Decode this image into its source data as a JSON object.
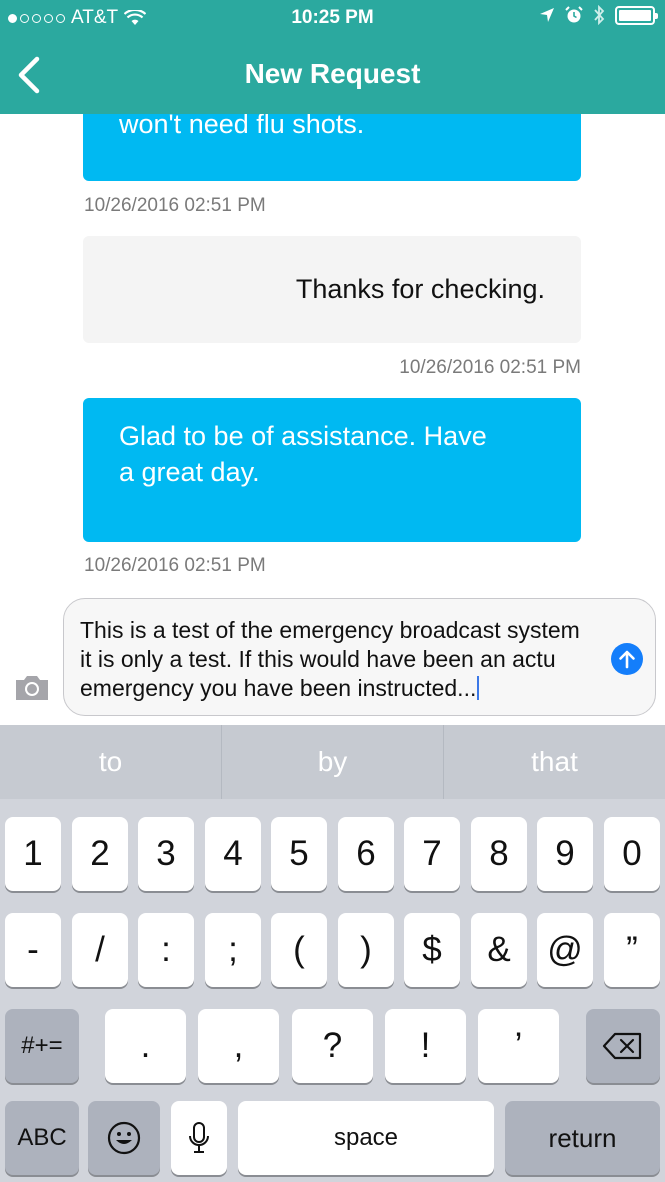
{
  "status_bar": {
    "carrier": "AT&T",
    "time": "10:25 PM"
  },
  "nav": {
    "title": "New Request"
  },
  "messages": [
    {
      "text_lines": [
        "won't need flu shots."
      ],
      "timestamp": "10/26/2016 02:51 PM",
      "sender": "agent"
    },
    {
      "text_lines": [
        "Thanks for checking."
      ],
      "timestamp": "10/26/2016 02:51 PM",
      "sender": "user"
    },
    {
      "text_lines": [
        "Glad to be of assistance. Have",
        "a great day."
      ],
      "timestamp": "10/26/2016 02:51 PM",
      "sender": "agent"
    }
  ],
  "composer": {
    "lines": [
      "This is a test of the emergency broadcast system",
      "it is only a test. If this would have been an actu",
      "emergency you have been instructed..."
    ]
  },
  "keyboard": {
    "suggestions": [
      "to",
      "by",
      "that"
    ],
    "row1": [
      "1",
      "2",
      "3",
      "4",
      "5",
      "6",
      "7",
      "8",
      "9",
      "0"
    ],
    "row2": [
      "-",
      "/",
      ":",
      ";",
      "(",
      ")",
      "$",
      "&",
      "@",
      "”"
    ],
    "row3_toggle": "#+=",
    "row3": [
      ".",
      ",",
      "?",
      "!",
      "’"
    ],
    "abc": "ABC",
    "space": "space",
    "return": "return"
  },
  "colors": {
    "header": "#2ba99f",
    "agent_bubble": "#00b9f2",
    "user_bubble": "#f4f4f4",
    "send_button": "#147efb"
  }
}
